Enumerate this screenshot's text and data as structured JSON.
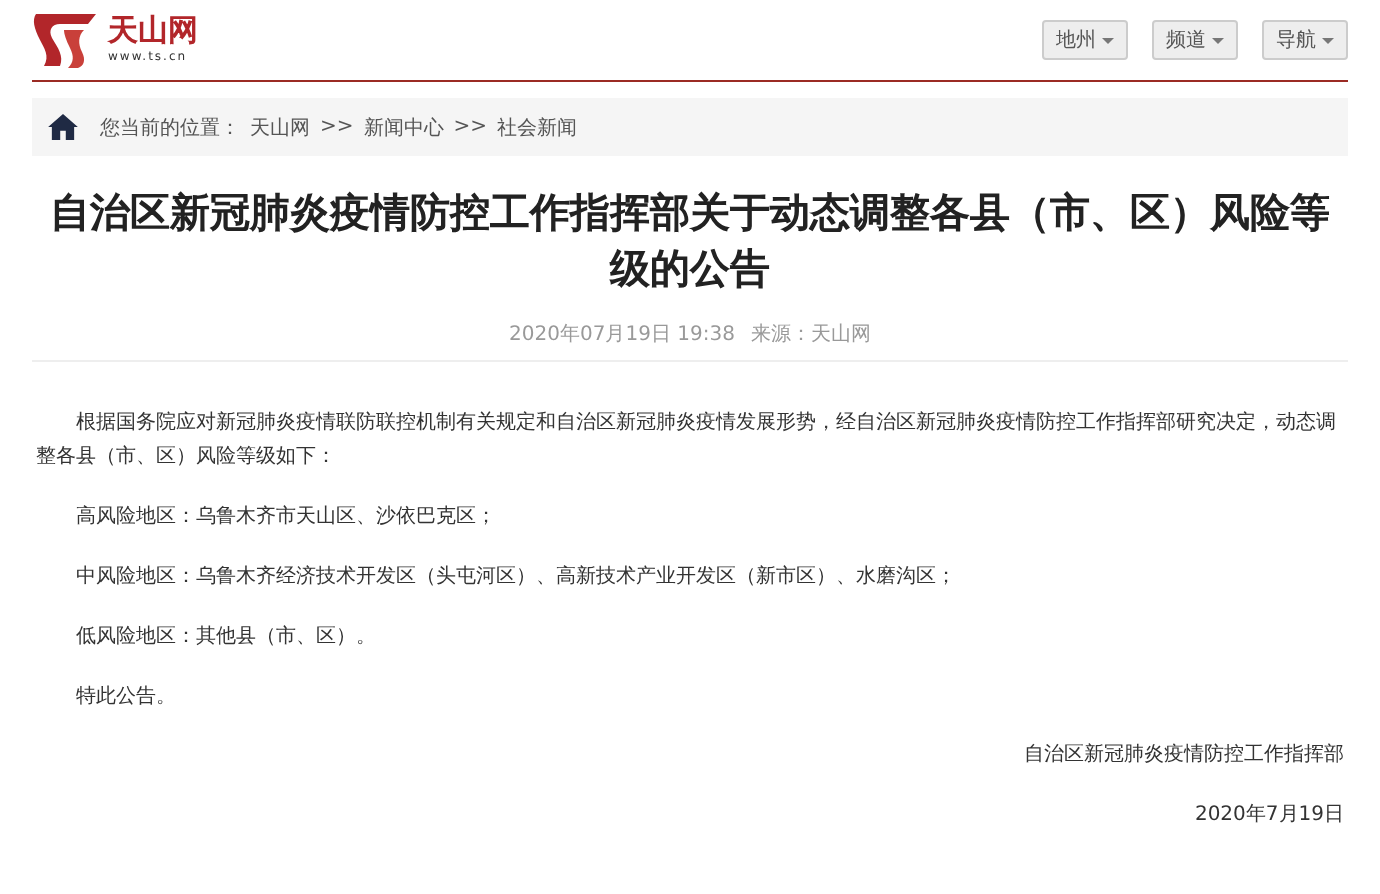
{
  "header": {
    "logo": {
      "name": "天山网",
      "url": "www.ts.cn"
    },
    "nav_buttons": [
      {
        "label": "地州"
      },
      {
        "label": "频道"
      },
      {
        "label": "导航"
      }
    ]
  },
  "breadcrumb": {
    "prefix": "您当前的位置：",
    "crumbs": [
      {
        "label": "天山网",
        "separator": ">>"
      },
      {
        "label": "新闻中心",
        "separator": ">>"
      },
      {
        "label": "社会新闻"
      }
    ]
  },
  "article": {
    "title": "自治区新冠肺炎疫情防控工作指挥部关于动态调整各县（市、区）风险等级的公告",
    "datetime": "2020年07月19日 19:38",
    "source": "来源：天山网",
    "paragraphs": [
      "根据国务院应对新冠肺炎疫情联防联控机制有关规定和自治区新冠肺炎疫情发展形势，经自治区新冠肺炎疫情防控工作指挥部研究决定，动态调整各县（市、区）风险等级如下：",
      "高风险地区：乌鲁木齐市天山区、沙依巴克区；",
      "中风险地区：乌鲁木齐经济技术开发区（头屯河区）、高新技术产业开发区（新市区）、水磨沟区；",
      "低风险地区：其他县（市、区）。",
      "特此公告。"
    ],
    "signature": "自治区新冠肺炎疫情防控工作指挥部",
    "date": "2020年7月19日"
  }
}
